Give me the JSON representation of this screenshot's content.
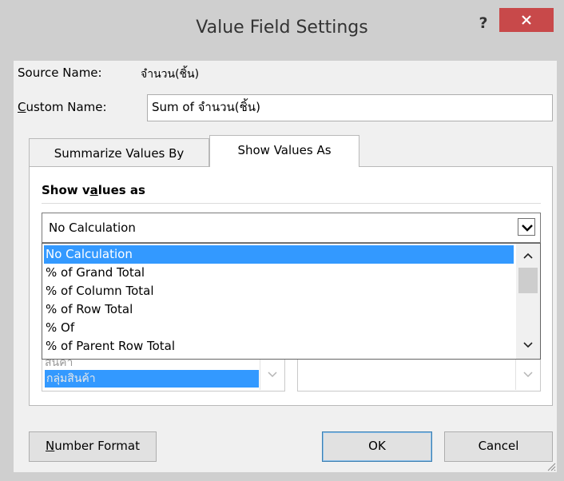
{
  "dialog": {
    "title": "Value Field Settings",
    "help_label": "?",
    "close_icon": "close-icon"
  },
  "source": {
    "label": "Source Name:",
    "value": "จำนวน(ชิ้น)"
  },
  "custom": {
    "label_accel": "C",
    "label_rest": "ustom Name:",
    "value": "Sum of จำนวน(ชิ้น)"
  },
  "tabs": [
    {
      "label": "Summarize Values By",
      "active": false
    },
    {
      "label": "Show Values As",
      "active": true
    }
  ],
  "show_values": {
    "heading_pre": "Show v",
    "heading_accel": "a",
    "heading_post": "lues as",
    "selected": "No Calculation",
    "options": [
      "No Calculation",
      "% of Grand Total",
      "% of Column Total",
      "% of Row Total",
      "% Of",
      "% of Parent Row Total"
    ],
    "highlighted_index": 0
  },
  "base": {
    "field_partial": "สินค้า",
    "field_selected": "กลุ่มสินค้า"
  },
  "buttons": {
    "number_format_accel": "N",
    "number_format_rest": "umber Format",
    "ok": "OK",
    "cancel": "Cancel"
  },
  "colors": {
    "selection": "#3399ff",
    "close_button": "#c8494a",
    "titlebar": "#cfcfcf"
  }
}
